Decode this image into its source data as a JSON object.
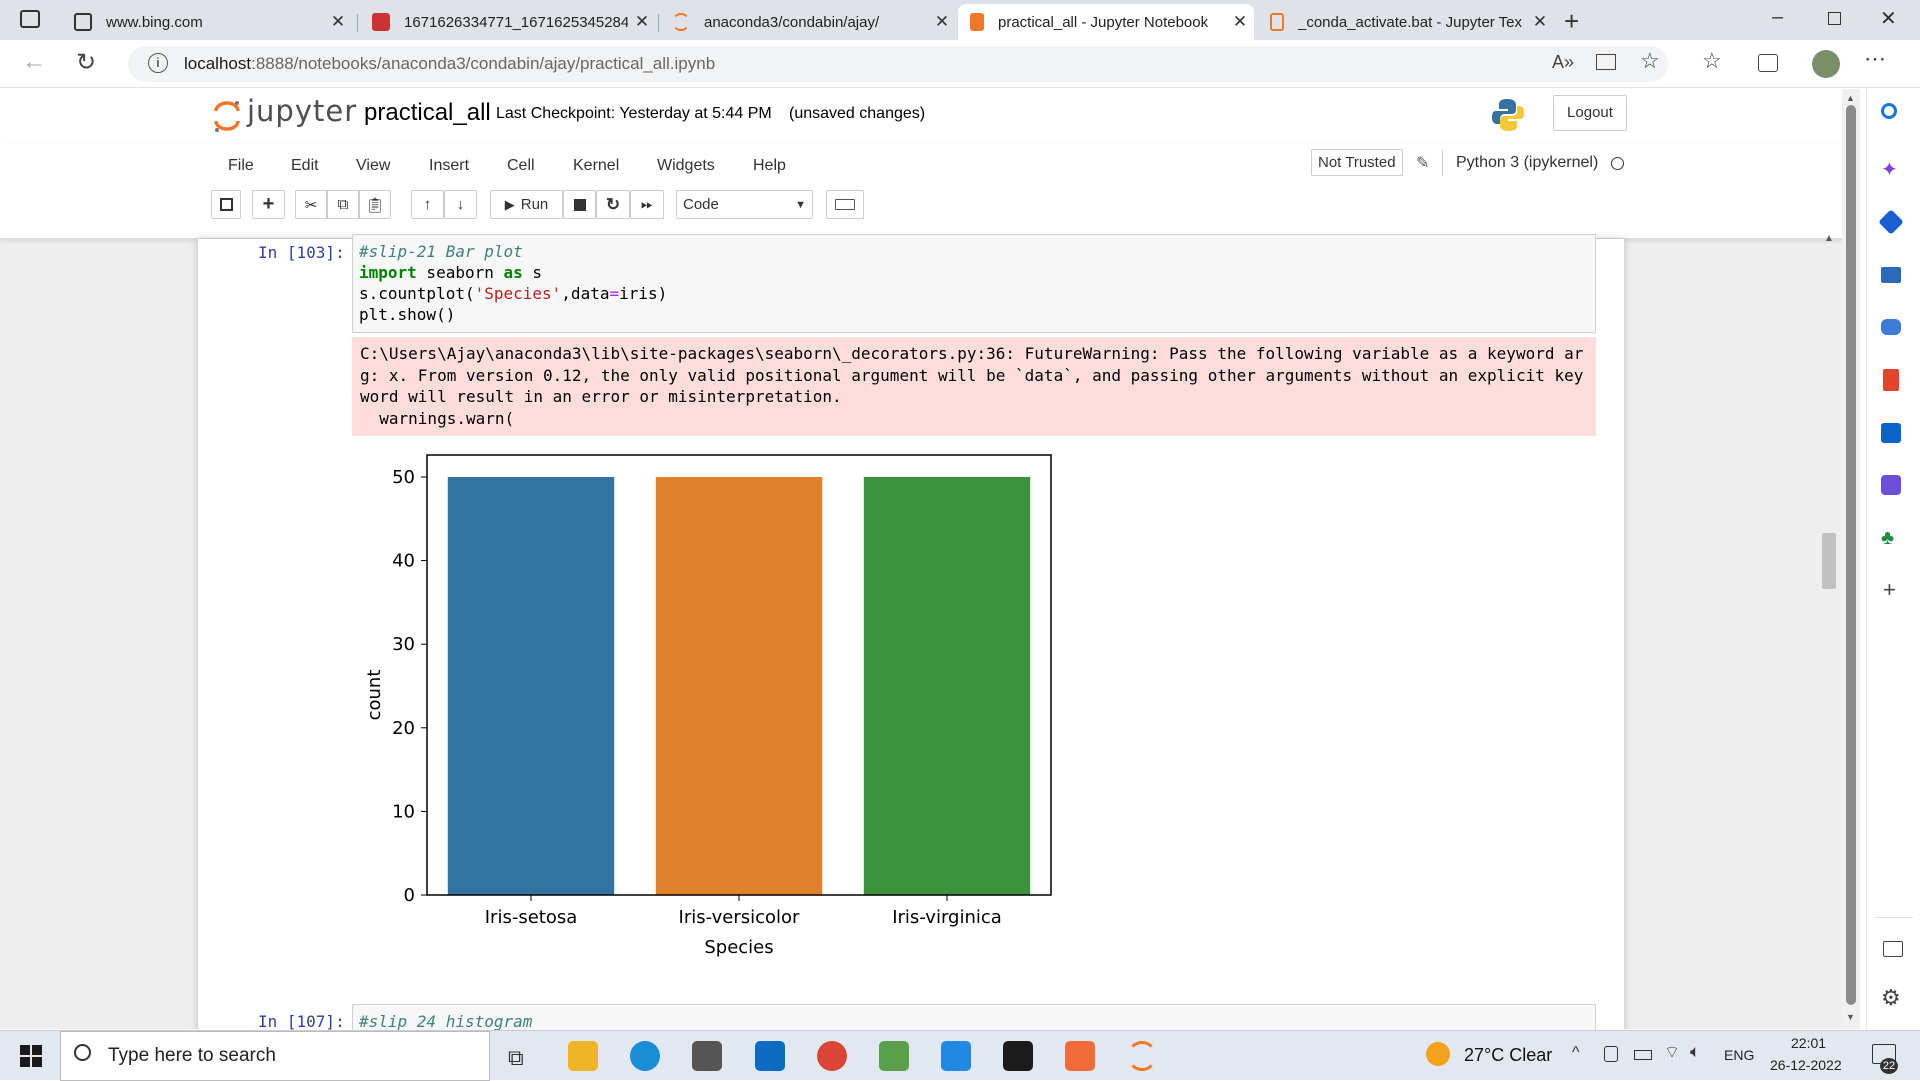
{
  "browser": {
    "tabs": [
      {
        "label": "www.bing.com"
      },
      {
        "label": "1671626334771_1671625345284"
      },
      {
        "label": "anaconda3/condabin/ajay/"
      },
      {
        "label": "practical_all - Jupyter Notebook"
      },
      {
        "label": "_conda_activate.bat - Jupyter Tex"
      }
    ],
    "url_host": "localhost",
    "url_rest": ":8888/notebooks/anaconda3/condabin/ajay/practical_all.ipynb"
  },
  "jupyter": {
    "logo_text": "jupyter",
    "notebook_name": "practical_all",
    "checkpoint": "Last Checkpoint: Yesterday at 5:44 PM",
    "unsaved": "(unsaved changes)",
    "logout": "Logout",
    "menu": [
      "File",
      "Edit",
      "View",
      "Insert",
      "Cell",
      "Kernel",
      "Widgets",
      "Help"
    ],
    "not_trusted": "Not Trusted",
    "kernel": "Python 3 (ipykernel)",
    "run_label": "Run",
    "cell_type": "Code"
  },
  "cells": [
    {
      "prompt": "In [103]:",
      "line1": "#slip-21 Bar plot",
      "stderr": "C:\\Users\\Ajay\\anaconda3\\lib\\site-packages\\seaborn\\_decorators.py:36: FutureWarning: Pass the following variable as a keyword arg: x. From version 0.12, the only valid positional argument will be `data`, and passing other arguments without an explicit keyword will result in an error or misinterpretation.\n  warnings.warn("
    },
    {
      "prompt": "In [107]:",
      "line1": "#slip 24 histogram"
    }
  ],
  "chart_data": {
    "type": "bar",
    "categories": [
      "Iris-setosa",
      "Iris-versicolor",
      "Iris-virginica"
    ],
    "values": [
      50,
      50,
      50
    ],
    "colors": [
      "#3274a1",
      "#e1812c",
      "#3a923a"
    ],
    "xlabel": "Species",
    "ylabel": "count",
    "ylim": [
      0,
      50
    ],
    "yticks": [
      0,
      10,
      20,
      30,
      40,
      50
    ]
  },
  "taskbar": {
    "search": "Type here to search",
    "weather": "27°C  Clear",
    "lang": "ENG",
    "time": "22:01",
    "date": "26-12-2022",
    "notif": "22"
  }
}
